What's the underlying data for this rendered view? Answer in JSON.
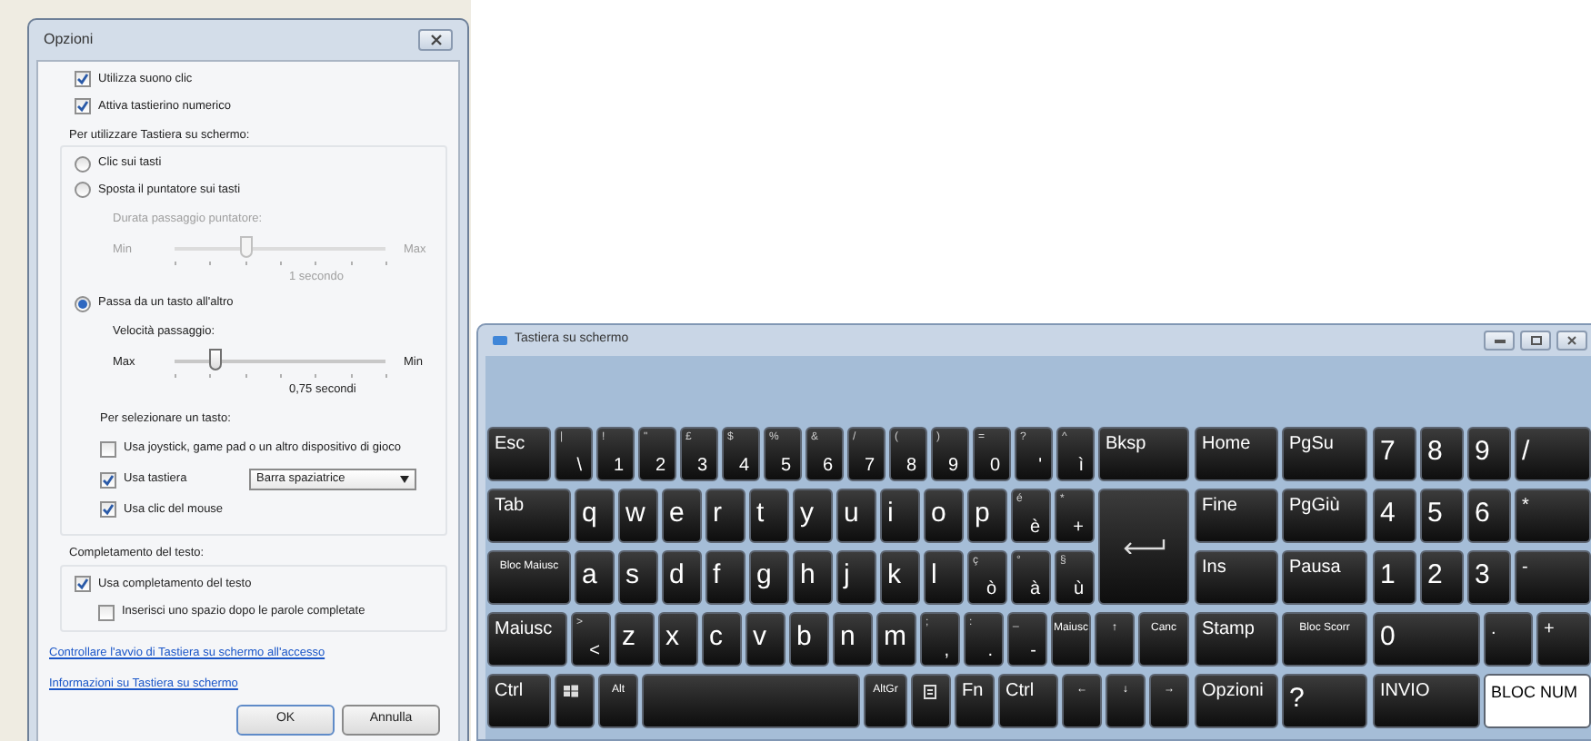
{
  "options_dialog": {
    "title": "Opzioni",
    "top_checkboxes": [
      {
        "label": "Utilizza suono clic",
        "checked": true
      },
      {
        "label": "Attiva tastierino numerico",
        "checked": true
      }
    ],
    "mode_group": {
      "label": "Per utilizzare Tastiera su schermo:",
      "modes": [
        {
          "label": "Clic sui tasti",
          "selected": false
        },
        {
          "label": "Sposta il puntatore sui tasti",
          "selected": false,
          "slider": {
            "caption": "Durata passaggio puntatore:",
            "disabled": true,
            "left_label": "Min",
            "right_label": "Max",
            "level": 0.34,
            "reading": "1 secondo"
          }
        },
        {
          "label": "Passa da un tasto all'altro",
          "selected": true,
          "slider": {
            "caption": "Velocità passaggio:",
            "disabled": false,
            "left_label": "Max",
            "right_label": "Min",
            "level": 0.19,
            "reading": "0,75 secondi"
          }
        }
      ],
      "select_heading": "Per selezionare un tasto:",
      "select_options": [
        {
          "label": "Usa joystick, game pad o un altro dispositivo di gioco",
          "checked": false
        },
        {
          "label": "Usa tastiera",
          "checked": true,
          "dropdown": "Barra spaziatrice"
        },
        {
          "label": "Usa clic del mouse",
          "checked": true
        }
      ]
    },
    "completion_group": {
      "label": "Completamento del testo:",
      "options": [
        {
          "label": "Usa completamento del testo",
          "checked": true,
          "children": [
            {
              "label": "Inserisci uno spazio dopo le parole completate",
              "checked": false
            }
          ]
        }
      ]
    },
    "links": [
      "Controllare l'avvio di Tastiera su schermo all'accesso",
      "Informazioni su Tastiera su schermo"
    ],
    "buttons": [
      "OK",
      "Annulla"
    ]
  },
  "keyboard_window": {
    "title": "Tastiera su schermo",
    "main_rows": [
      [
        {
          "kind": "function",
          "label": "Esc"
        },
        {
          "kind": "dual",
          "top": "|",
          "label": "\\"
        },
        {
          "kind": "dual",
          "top": "!",
          "label": "1"
        },
        {
          "kind": "dual",
          "top": "\"",
          "label": "2"
        },
        {
          "kind": "dual",
          "top": "£",
          "label": "3"
        },
        {
          "kind": "dual",
          "top": "$",
          "label": "4"
        },
        {
          "kind": "dual",
          "top": "%",
          "label": "5"
        },
        {
          "kind": "dual",
          "top": "&",
          "label": "6"
        },
        {
          "kind": "dual",
          "top": "/",
          "label": "7"
        },
        {
          "kind": "dual",
          "top": "(",
          "label": "8"
        },
        {
          "kind": "dual",
          "top": ")",
          "label": "9"
        },
        {
          "kind": "dual",
          "top": "=",
          "label": "0"
        },
        {
          "kind": "dual",
          "top": "?",
          "label": "'"
        },
        {
          "kind": "dual",
          "top": "^",
          "label": "ì"
        },
        {
          "kind": "function",
          "label": "Bksp"
        }
      ],
      [
        {
          "kind": "function",
          "label": "Tab"
        },
        {
          "kind": "letter",
          "label": "q"
        },
        {
          "kind": "letter",
          "label": "w"
        },
        {
          "kind": "letter",
          "label": "e"
        },
        {
          "kind": "letter",
          "label": "r"
        },
        {
          "kind": "letter",
          "label": "t"
        },
        {
          "kind": "letter",
          "label": "y"
        },
        {
          "kind": "letter",
          "label": "u"
        },
        {
          "kind": "letter",
          "label": "i"
        },
        {
          "kind": "letter",
          "label": "o"
        },
        {
          "kind": "letter",
          "label": "p"
        },
        {
          "kind": "dual",
          "top": "é",
          "label": "è"
        },
        {
          "kind": "dual",
          "top": "*",
          "label": "+"
        }
      ],
      [
        {
          "kind": "small",
          "label": "Bloc Maiusc"
        },
        {
          "kind": "letter",
          "label": "a"
        },
        {
          "kind": "letter",
          "label": "s"
        },
        {
          "kind": "letter",
          "label": "d"
        },
        {
          "kind": "letter",
          "label": "f"
        },
        {
          "kind": "letter",
          "label": "g"
        },
        {
          "kind": "letter",
          "label": "h"
        },
        {
          "kind": "letter",
          "label": "j"
        },
        {
          "kind": "letter",
          "label": "k"
        },
        {
          "kind": "letter",
          "label": "l"
        },
        {
          "kind": "dual",
          "top": "ç",
          "label": "ò"
        },
        {
          "kind": "dual",
          "top": "°",
          "label": "à"
        },
        {
          "kind": "dual",
          "top": "§",
          "label": "ù"
        }
      ],
      [
        {
          "kind": "function",
          "label": "Maiusc"
        },
        {
          "kind": "dual",
          "top": ">",
          "label": "<"
        },
        {
          "kind": "letter",
          "label": "z"
        },
        {
          "kind": "letter",
          "label": "x"
        },
        {
          "kind": "letter",
          "label": "c"
        },
        {
          "kind": "letter",
          "label": "v"
        },
        {
          "kind": "letter",
          "label": "b"
        },
        {
          "kind": "letter",
          "label": "n"
        },
        {
          "kind": "letter",
          "label": "m"
        },
        {
          "kind": "dual",
          "top": ";",
          "label": ","
        },
        {
          "kind": "dual",
          "top": ":",
          "label": "."
        },
        {
          "kind": "dual",
          "top": "_",
          "label": "-"
        },
        {
          "kind": "small",
          "label": "Maiusc"
        },
        {
          "kind": "small",
          "label": "↑"
        },
        {
          "kind": "small",
          "label": "Canc"
        }
      ],
      [
        {
          "kind": "function",
          "label": "Ctrl"
        },
        {
          "kind": "windows"
        },
        {
          "kind": "small",
          "label": "Alt"
        },
        {
          "kind": "space"
        },
        {
          "kind": "small",
          "label": "AltGr"
        },
        {
          "kind": "menu"
        },
        {
          "kind": "function",
          "label": "Fn"
        },
        {
          "kind": "function",
          "label": "Ctrl"
        },
        {
          "kind": "small",
          "label": "←"
        },
        {
          "kind": "small",
          "label": "↓"
        },
        {
          "kind": "small",
          "label": "→"
        }
      ]
    ],
    "enter_key": {
      "kind": "enter"
    },
    "nav_rows": [
      [
        {
          "kind": "function",
          "label": "Home"
        },
        {
          "kind": "function",
          "label": "PgSu"
        }
      ],
      [
        {
          "kind": "function",
          "label": "Fine"
        },
        {
          "kind": "function",
          "label": "PgGiù"
        }
      ],
      [
        {
          "kind": "function",
          "label": "Ins"
        },
        {
          "kind": "function",
          "label": "Pausa"
        }
      ],
      [
        {
          "kind": "function",
          "label": "Stamp"
        },
        {
          "kind": "small",
          "label": "Bloc Scorr"
        }
      ],
      [
        {
          "kind": "function",
          "label": "Opzioni"
        },
        {
          "kind": "letter",
          "label": "?"
        }
      ]
    ],
    "numpad_rows": [
      [
        {
          "kind": "letter",
          "label": "7"
        },
        {
          "kind": "letter",
          "label": "8"
        },
        {
          "kind": "letter",
          "label": "9"
        },
        {
          "kind": "letter",
          "label": "/"
        }
      ],
      [
        {
          "kind": "letter",
          "label": "4"
        },
        {
          "kind": "letter",
          "label": "5"
        },
        {
          "kind": "letter",
          "label": "6"
        },
        {
          "kind": "function",
          "label": "*"
        }
      ],
      [
        {
          "kind": "letter",
          "label": "1"
        },
        {
          "kind": "letter",
          "label": "2"
        },
        {
          "kind": "letter",
          "label": "3"
        },
        {
          "kind": "function",
          "label": "-"
        }
      ],
      [
        {
          "kind": "letter",
          "label": "0"
        },
        {
          "kind": "function",
          "label": "."
        },
        {
          "kind": "function",
          "label": "+"
        }
      ],
      [
        {
          "kind": "function",
          "label": "INVIO"
        },
        {
          "kind": "toggle",
          "label": "BLOC NUM",
          "on": true
        }
      ]
    ]
  }
}
